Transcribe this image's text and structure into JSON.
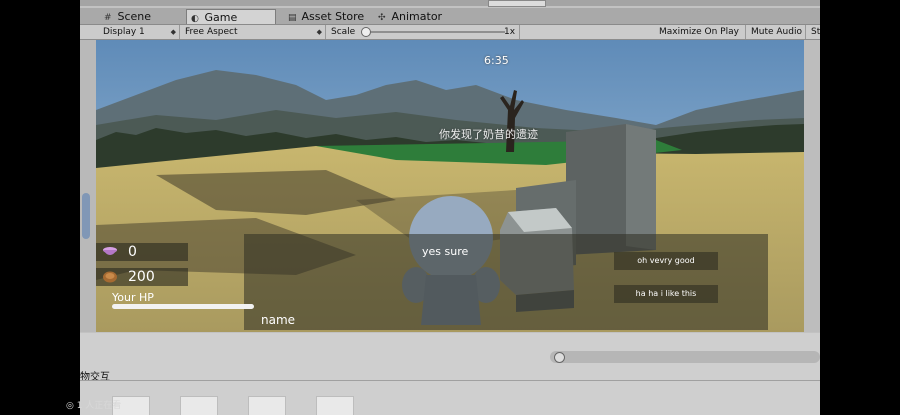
{
  "tabs": [
    {
      "label": "Scene",
      "icon": "grid-icon"
    },
    {
      "label": "Game",
      "icon": "pacman-icon",
      "active": true
    },
    {
      "label": "Asset Store",
      "icon": "store-icon"
    },
    {
      "label": "Animator",
      "icon": "animator-icon"
    }
  ],
  "toolbar": {
    "display": "Display 1",
    "aspect": "Free Aspect",
    "scale_label": "Scale",
    "scale_value": "1x",
    "maximize": "Maximize On Play",
    "mute": "Mute Audio",
    "stats": "St"
  },
  "game": {
    "timer": "6:35",
    "message": "你发现了奶昔的遗迹",
    "dialog_line": "yes sure",
    "choices": [
      "oh vevry good",
      "ha ha i like this"
    ],
    "gems": "0",
    "coins": "200",
    "hp_label": "Your HP",
    "hp_fraction": 1.0,
    "name_label": "name"
  },
  "bottom": {
    "panel_label": "物交互"
  },
  "overlay": {
    "viewers": "1 人正在看"
  },
  "colors": {
    "sky": "#6f97bd",
    "ground": "#cbb772",
    "grass": "#2e7d3a",
    "gem": "#c48bd6",
    "coin": "#a56a32"
  }
}
